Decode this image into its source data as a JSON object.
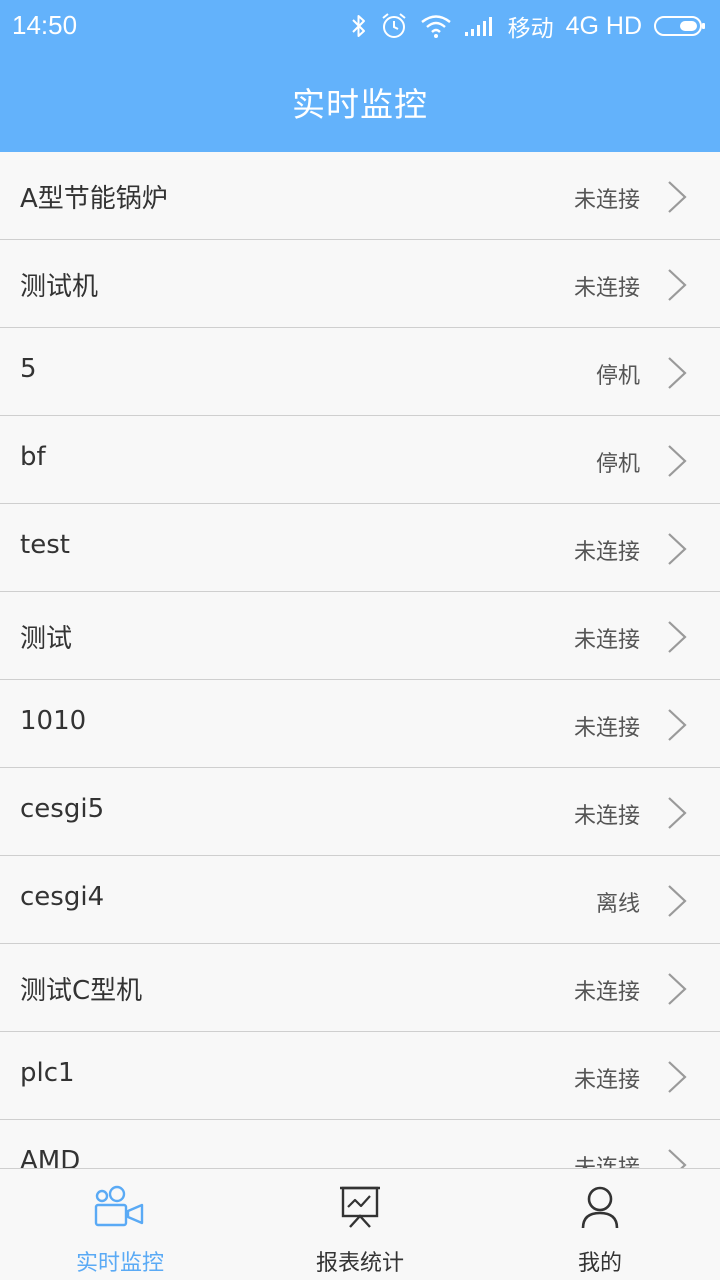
{
  "status_bar": {
    "time": "14:50",
    "carrier": "移动",
    "network": "4G HD",
    "icons": [
      "bluetooth-icon",
      "alarm-icon",
      "wifi-icon",
      "signal-icon",
      "battery-icon"
    ]
  },
  "header": {
    "title": "实时监控"
  },
  "devices": [
    {
      "name": "A型节能锅炉",
      "status": "未连接"
    },
    {
      "name": "测试机",
      "status": "未连接"
    },
    {
      "name": "5",
      "status": "停机"
    },
    {
      "name": "bf",
      "status": "停机"
    },
    {
      "name": "test",
      "status": "未连接"
    },
    {
      "name": "测试",
      "status": "未连接"
    },
    {
      "name": "1010",
      "status": "未连接"
    },
    {
      "name": "cesgi5",
      "status": "未连接"
    },
    {
      "name": "cesgi4",
      "status": "离线"
    },
    {
      "name": "测试C型机",
      "status": "未连接"
    },
    {
      "name": "plc1",
      "status": "未连接"
    },
    {
      "name": "AMD",
      "status": "未连接"
    }
  ],
  "bottom_nav": [
    {
      "label": "实时监控",
      "icon": "camera-icon",
      "active": true
    },
    {
      "label": "报表统计",
      "icon": "chart-board-icon",
      "active": false
    },
    {
      "label": "我的",
      "icon": "user-icon",
      "active": false
    }
  ],
  "colors": {
    "header_bg": "#63b2fb",
    "active_nav": "#5aaaf5",
    "text": "#333333",
    "divider": "#cfcfcf"
  }
}
